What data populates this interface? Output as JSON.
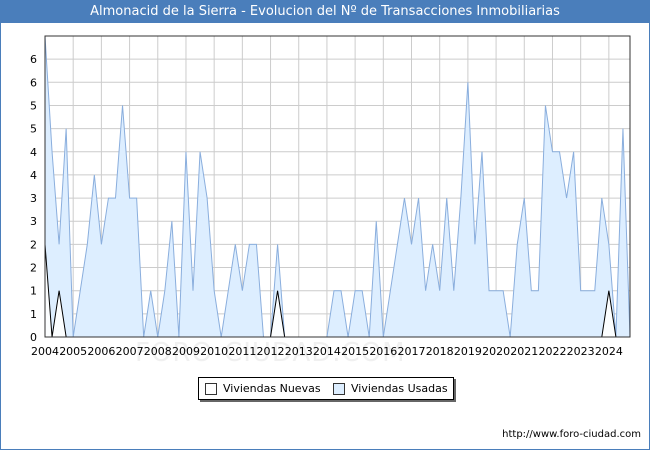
{
  "page": {
    "title": "Almonacid de la Sierra - Evolucion del Nº de Transacciones Inmobiliarias"
  },
  "footer": {
    "credit": "http://www.foro-ciudad.com",
    "watermark": "FORO-CIUDAD.COM"
  },
  "colors": {
    "header": "#4a7ebb",
    "nuevas_fill": "#ffffff",
    "usadas_fill": "#ddeeff",
    "usadas_line": "#8aaedd",
    "nuevas_line": "#000000",
    "grid": "#cccccc"
  },
  "chart_data": {
    "type": "area",
    "title": "Almonacid de la Sierra - Evolucion del Nº de Transacciones Inmobiliarias",
    "xlabel": "",
    "ylabel": "",
    "xlim": [
      2004,
      2024.75
    ],
    "ylim": [
      0,
      6.5
    ],
    "x_tick_labels": [
      "2004",
      "2005",
      "2006",
      "2007",
      "2008",
      "2009",
      "2010",
      "2011",
      "2012",
      "2013",
      "2014",
      "2015",
      "2016",
      "2017",
      "2018",
      "2019",
      "2020",
      "2021",
      "2022",
      "2023",
      "2024"
    ],
    "y_tick_labels": [
      "0",
      "1",
      "1",
      "2",
      "2",
      "3",
      "3",
      "4",
      "4",
      "5",
      "5",
      "6",
      "6"
    ],
    "grid": true,
    "legend_position": "bottom-center",
    "series": [
      {
        "name": "Viviendas Nuevas",
        "x": [
          2004.0,
          2004.25,
          2004.5,
          2004.75,
          2005.0,
          2005.25,
          2005.5,
          2005.75,
          2006.0,
          2006.25,
          2006.5,
          2006.75,
          2007.0,
          2007.25,
          2007.5,
          2007.75,
          2008.0,
          2008.25,
          2008.5,
          2008.75,
          2009.0,
          2009.25,
          2009.5,
          2009.75,
          2010.0,
          2010.25,
          2010.5,
          2010.75,
          2011.0,
          2011.25,
          2011.5,
          2011.75,
          2012.0,
          2012.25,
          2012.5,
          2012.75,
          2013.0,
          2013.25,
          2013.5,
          2013.75,
          2014.0,
          2014.25,
          2014.5,
          2014.75,
          2015.0,
          2015.25,
          2015.5,
          2015.75,
          2016.0,
          2016.25,
          2016.5,
          2016.75,
          2017.0,
          2017.25,
          2017.5,
          2017.75,
          2018.0,
          2018.25,
          2018.5,
          2018.75,
          2019.0,
          2019.25,
          2019.5,
          2019.75,
          2020.0,
          2020.25,
          2020.5,
          2020.75,
          2021.0,
          2021.25,
          2021.5,
          2021.75,
          2022.0,
          2022.25,
          2022.5,
          2022.75,
          2023.0,
          2023.25,
          2023.5,
          2023.75,
          2024.0,
          2024.25,
          2024.5,
          2024.75
        ],
        "values": [
          2,
          0,
          1,
          0,
          0,
          0,
          0,
          0,
          0,
          0,
          0,
          0,
          0,
          0,
          0,
          0,
          0,
          0,
          0,
          0,
          0,
          0,
          0,
          0,
          0,
          0,
          0,
          0,
          0,
          0,
          0,
          0,
          0,
          1,
          0,
          0,
          0,
          0,
          0,
          0,
          0,
          0,
          0,
          0,
          0,
          0,
          0,
          0,
          0,
          0,
          0,
          0,
          0,
          0,
          0,
          0,
          0,
          0,
          0,
          0,
          0,
          0,
          0,
          0,
          0,
          0,
          0,
          0,
          0,
          0,
          0,
          0,
          0,
          0,
          0,
          0,
          0,
          0,
          0,
          0,
          1,
          0,
          0,
          0
        ]
      },
      {
        "name": "Viviendas Usadas",
        "x": [
          2004.0,
          2004.25,
          2004.5,
          2004.75,
          2005.0,
          2005.25,
          2005.5,
          2005.75,
          2006.0,
          2006.25,
          2006.5,
          2006.75,
          2007.0,
          2007.25,
          2007.5,
          2007.75,
          2008.0,
          2008.25,
          2008.5,
          2008.75,
          2009.0,
          2009.25,
          2009.5,
          2009.75,
          2010.0,
          2010.25,
          2010.5,
          2010.75,
          2011.0,
          2011.25,
          2011.5,
          2011.75,
          2012.0,
          2012.25,
          2012.5,
          2012.75,
          2013.0,
          2013.25,
          2013.5,
          2013.75,
          2014.0,
          2014.25,
          2014.5,
          2014.75,
          2015.0,
          2015.25,
          2015.5,
          2015.75,
          2016.0,
          2016.25,
          2016.5,
          2016.75,
          2017.0,
          2017.25,
          2017.5,
          2017.75,
          2018.0,
          2018.25,
          2018.5,
          2018.75,
          2019.0,
          2019.25,
          2019.5,
          2019.75,
          2020.0,
          2020.25,
          2020.5,
          2020.75,
          2021.0,
          2021.25,
          2021.5,
          2021.75,
          2022.0,
          2022.25,
          2022.5,
          2022.75,
          2023.0,
          2023.25,
          2023.5,
          2023.75,
          2024.0,
          2024.25,
          2024.5,
          2024.75
        ],
        "values": [
          6.5,
          4,
          2,
          4.5,
          0,
          1,
          2,
          3.5,
          2,
          3,
          3,
          5,
          3,
          3,
          0,
          1,
          0,
          1,
          2.5,
          0,
          4,
          1,
          4,
          3,
          1,
          0,
          1,
          2,
          1,
          2,
          2,
          0,
          0,
          2,
          0,
          0,
          0,
          0,
          0,
          0,
          0,
          1,
          1,
          0,
          1,
          1,
          0,
          2.5,
          0,
          1,
          2,
          3,
          2,
          3,
          1,
          2,
          1,
          3,
          1,
          3,
          5.5,
          2,
          4,
          1,
          1,
          1,
          0,
          2,
          3,
          1,
          1,
          5,
          4,
          4,
          3,
          4,
          1,
          1,
          1,
          3,
          2,
          0,
          4.5,
          0
        ]
      }
    ]
  }
}
